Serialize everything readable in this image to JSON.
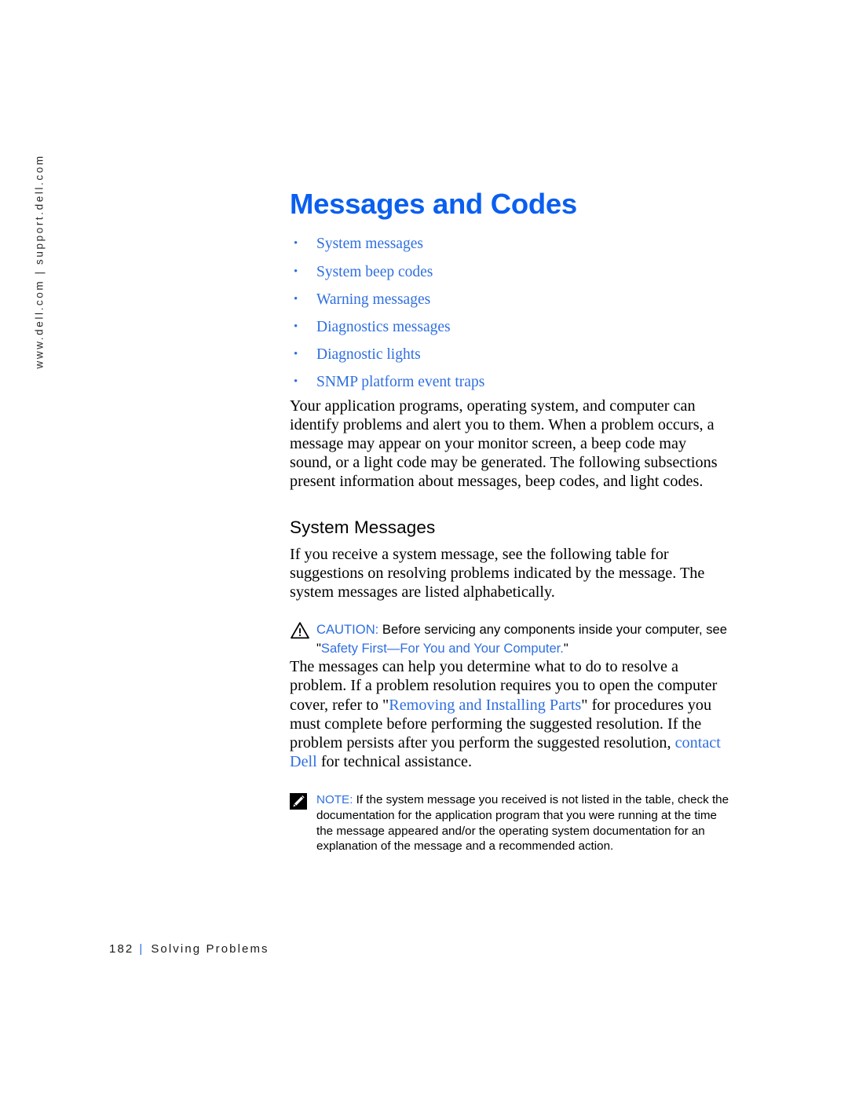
{
  "side_rail": {
    "text": "www.dell.com | support.dell.com"
  },
  "page": {
    "title": "Messages and Codes",
    "toc": [
      {
        "label": "System messages"
      },
      {
        "label": "System beep codes"
      },
      {
        "label": "Warning messages"
      },
      {
        "label": "Diagnostics messages"
      },
      {
        "label": "Diagnostic lights"
      },
      {
        "label": "SNMP platform event traps"
      }
    ],
    "intro_paragraph": "Your application programs, operating system, and computer can identify problems and alert you to them. When a problem occurs, a message may appear on your monitor screen, a beep code may sound, or a light code may be generated. The following subsections present information about messages, beep codes, and light codes.",
    "section_heading": "System Messages",
    "section_paragraph": "If you receive a system message, see the following table for suggestions on resolving problems indicated by the message. The system messages are listed alphabetically.",
    "caution": {
      "icon": "warning-triangle-icon",
      "label": "CAUTION:",
      "text_before": " Before servicing any components inside your computer, see \"",
      "link": "Safety First—For You and Your Computer.",
      "text_after": "\""
    },
    "post_caution_paragraph": {
      "text_1": "The messages can help you determine what to do to resolve a problem. If a problem resolution requires you to open the computer cover, refer to \"",
      "link_1": "Removing and Installing Parts",
      "text_2": "\" for procedures you must complete before performing the suggested resolution. If the problem persists after you perform the suggested resolution, ",
      "link_2": "contact Dell",
      "text_3": " for technical assistance."
    },
    "note": {
      "icon": "note-pencil-icon",
      "label": "NOTE:",
      "text": " If the system message you received is not listed in the table, check the documentation for the application program that you were running at the time the message appeared and/or the operating system documentation for an explanation of the message and a recommended action."
    }
  },
  "footer": {
    "page_number": "182",
    "separator": "|",
    "section": "Solving Problems"
  },
  "colors": {
    "title_blue": "#0a5ff0",
    "link_blue": "#2f6fe0",
    "text_black": "#000000"
  }
}
